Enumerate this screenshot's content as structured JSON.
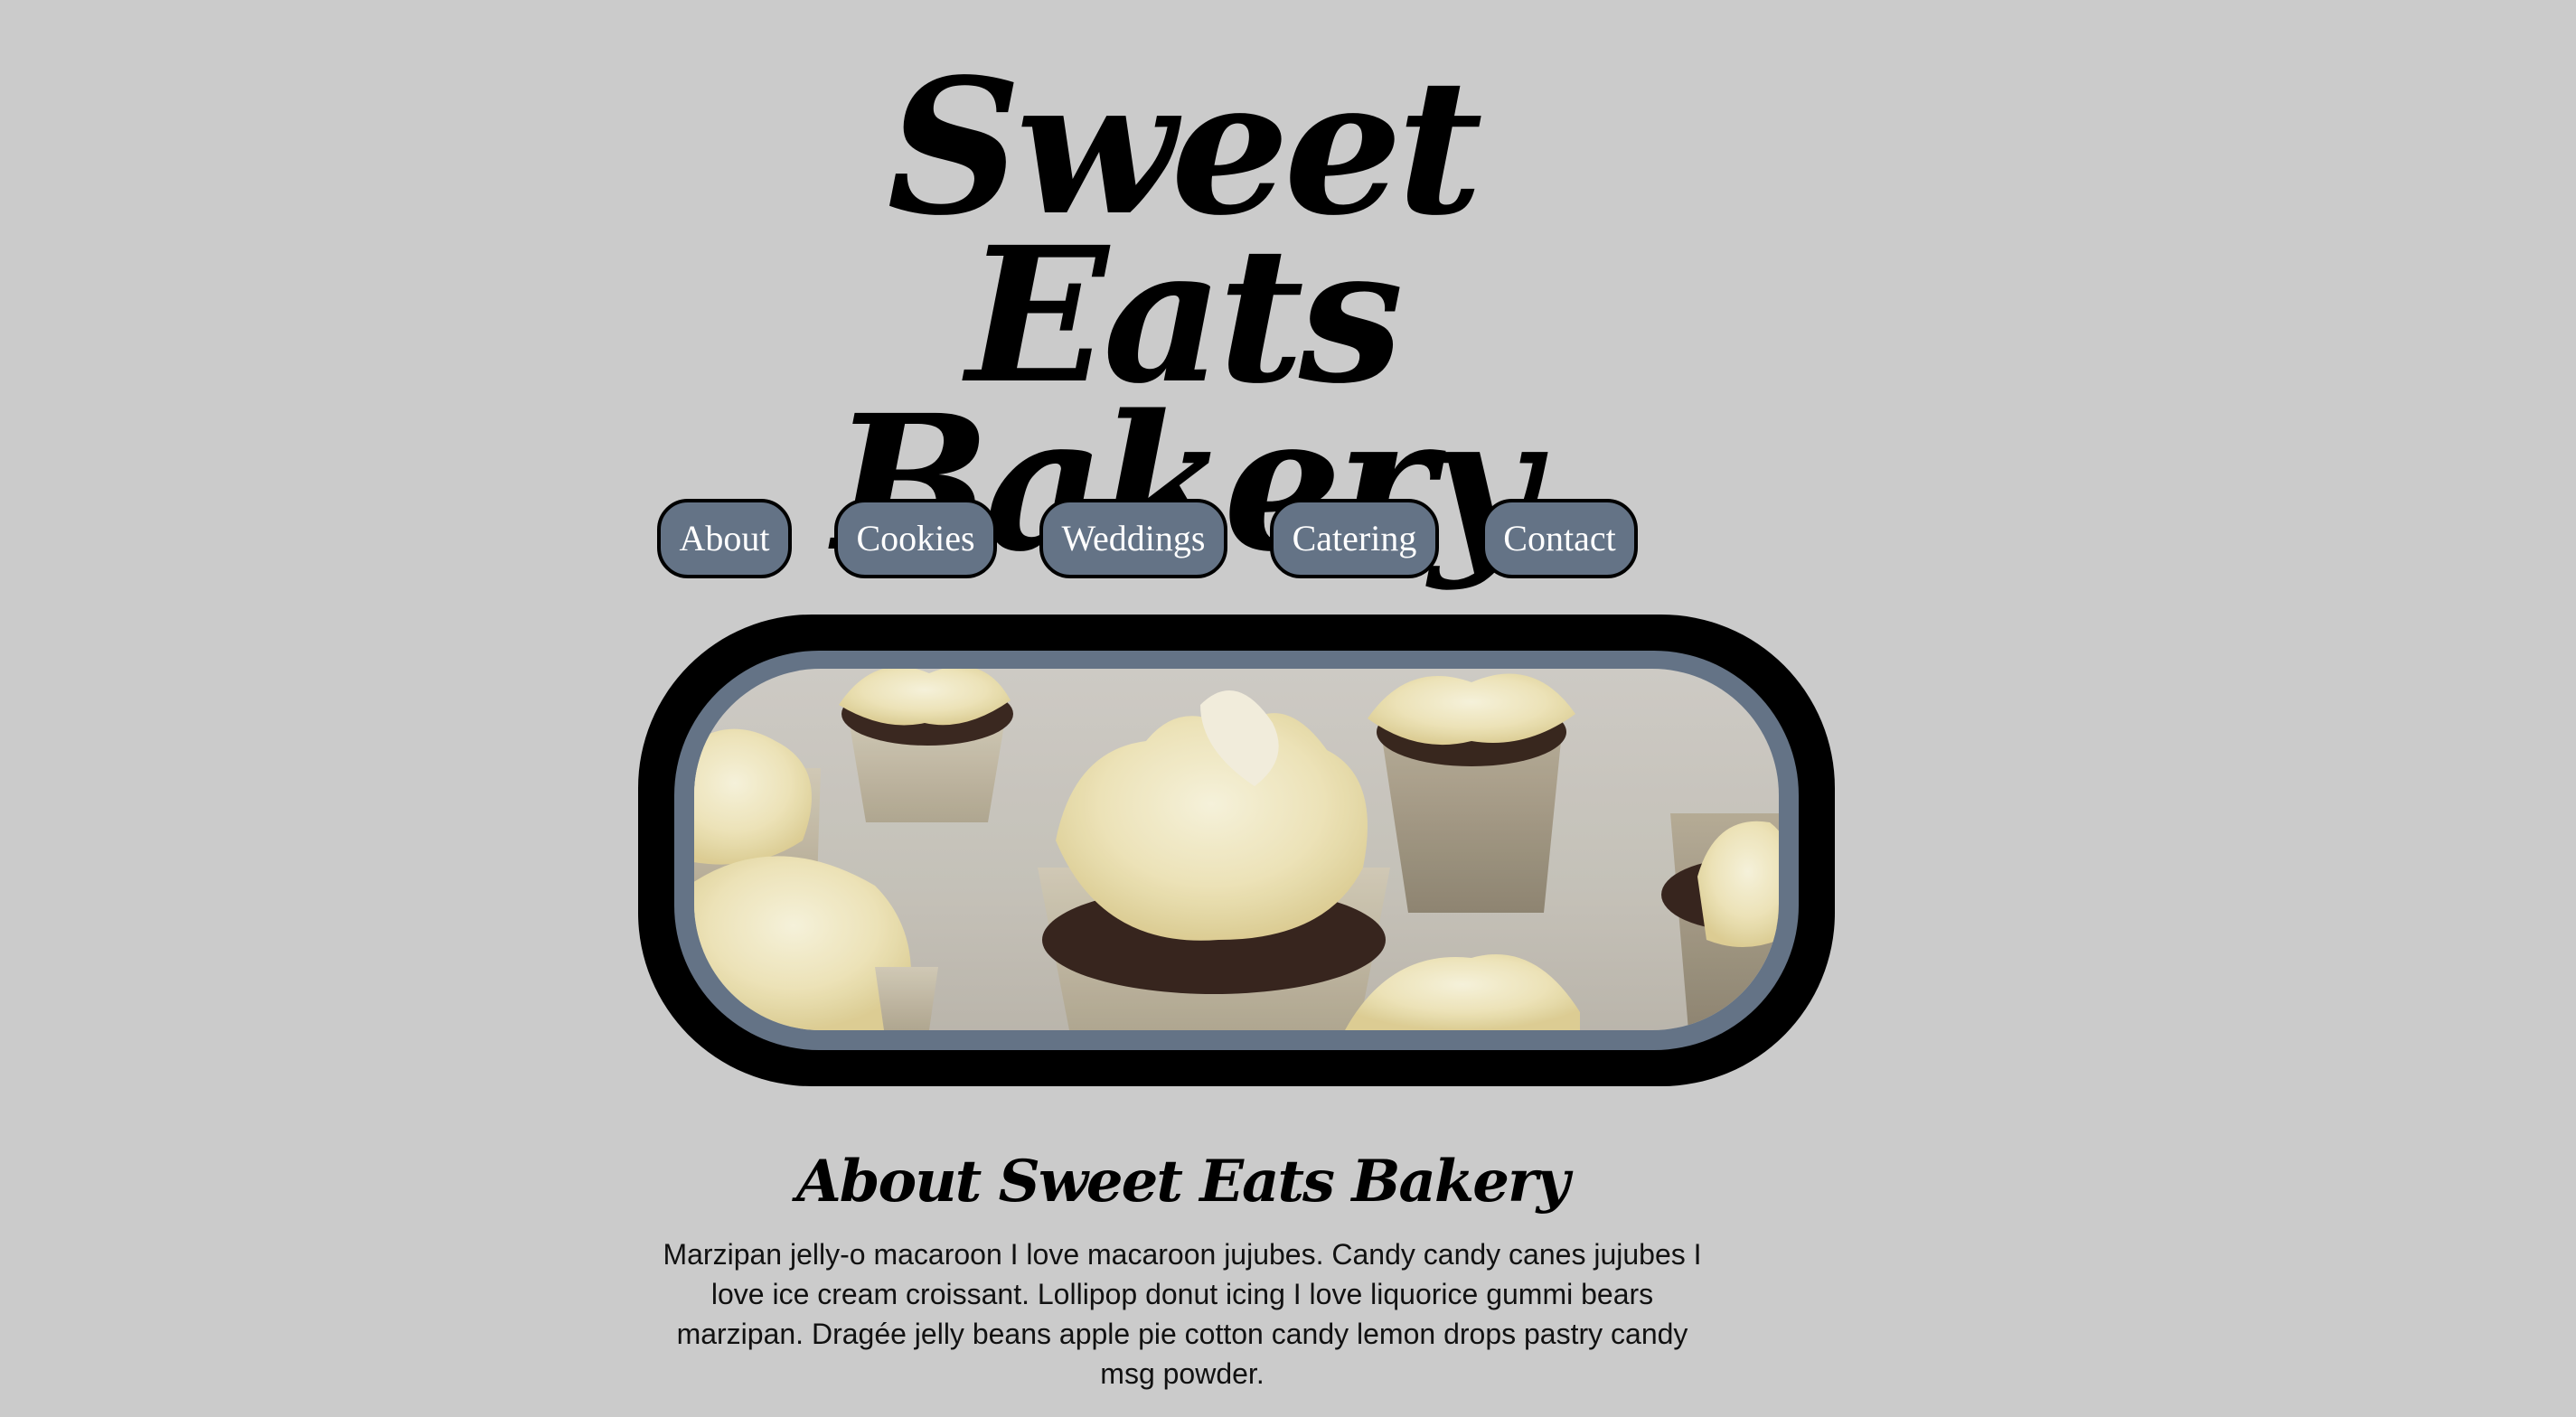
{
  "header": {
    "title": "Sweet Eats Bakery"
  },
  "nav": {
    "items": [
      {
        "label": "About"
      },
      {
        "label": "Cookies"
      },
      {
        "label": "Weddings"
      },
      {
        "label": "Catering"
      },
      {
        "label": "Contact"
      }
    ]
  },
  "hero": {
    "image_subject": "cupcakes with cream frosting"
  },
  "about": {
    "heading": "About Sweet Eats Bakery",
    "body": "Marzipan jelly-o macaroon I love macaroon jujubes. Candy candy canes jujubes I love ice cream croissant. Lollipop donut icing I love liquorice gummi bears marzipan. Dragée jelly beans apple pie cotton candy lemon drops pastry candy msg powder."
  },
  "colors": {
    "background": "#cbcbcb",
    "nav_button": "#647386",
    "frame_outer": "#000000",
    "frame_inner": "#647386",
    "text": "#000000"
  }
}
